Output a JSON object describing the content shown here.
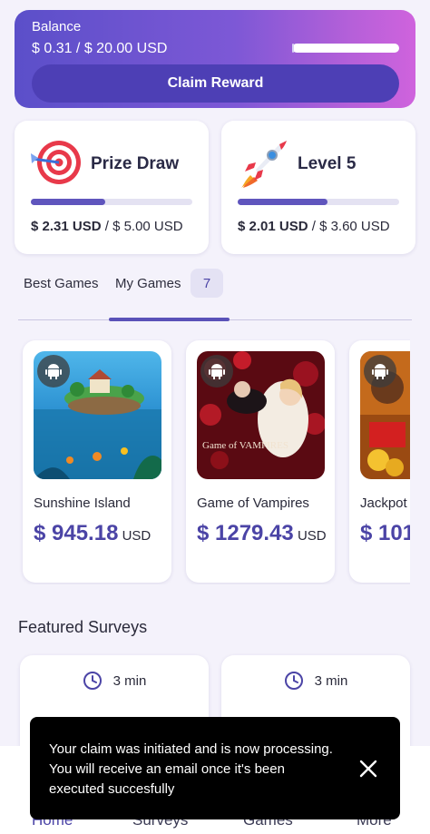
{
  "balance": {
    "label": "Balance",
    "value": "$ 0.31 / $ 20.00 USD",
    "progress": 0.0155,
    "claim_label": "Claim Reward"
  },
  "stats": [
    {
      "title": "Prize Draw",
      "icon": "target-icon",
      "progress": 0.462,
      "current": "$ 2.31 USD",
      "sep": " / ",
      "goal": "$ 5.00 USD"
    },
    {
      "title": "Level 5",
      "icon": "rocket-icon",
      "progress": 0.558,
      "current": "$ 2.01 USD",
      "sep": " / ",
      "goal": "$ 3.60 USD"
    }
  ],
  "tabs": {
    "best_games": "Best Games",
    "my_games": "My Games",
    "my_games_count": "7"
  },
  "games": [
    {
      "name": "Sunshine Island",
      "amount": "$ 945.18",
      "currency": "USD"
    },
    {
      "name": "Game of Vampires",
      "amount": "$ 1279.43",
      "currency": "USD",
      "image_text": "Game of VAMPIRES"
    },
    {
      "name": "Jackpot",
      "amount": "$ 101",
      "currency": ""
    }
  ],
  "featured": {
    "title": "Featured Surveys",
    "surveys": [
      {
        "time": "3 min"
      },
      {
        "time": "3 min"
      }
    ]
  },
  "nav": {
    "home": "Home",
    "surveys": "Surveys",
    "games": "Games",
    "more": "More"
  },
  "toast": {
    "message": "Your claim was initiated and is now processing. You will receive an email once it's been executed succesfully"
  },
  "colors": {
    "accent": "#4b44a6",
    "progress": "#5f55bd",
    "background": "#f4f2fb"
  }
}
